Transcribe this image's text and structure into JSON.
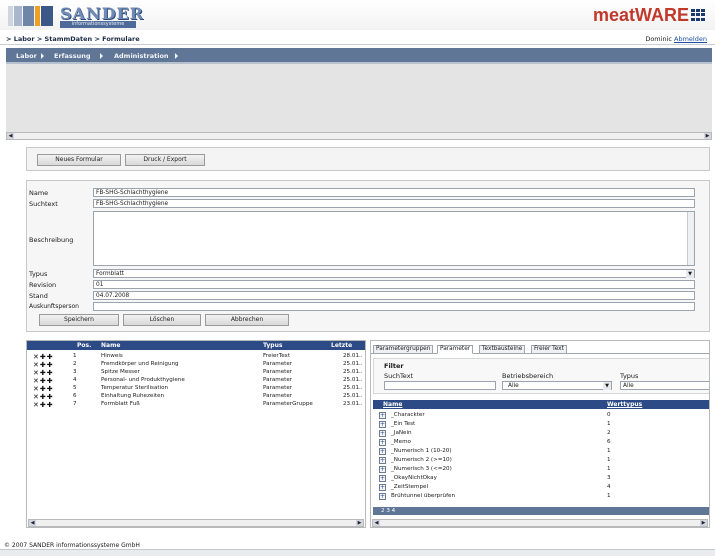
{
  "header": {
    "logo_word": "SANDER",
    "logo_sub": "informationssysteme",
    "brand": "meatWARE"
  },
  "breadcrumb": "> Labor > StammDaten > Formulare",
  "user": {
    "name": "Dominic",
    "logout": "Abmelden"
  },
  "nav": [
    "Labor",
    "Erfassung",
    "Administration"
  ],
  "toolbar": {
    "new": "Neues Formular",
    "print": "Druck / Export"
  },
  "form": {
    "labels": {
      "name": "Name",
      "suchtext": "Suchtext",
      "beschreibung": "Beschreibung",
      "typus": "Typus",
      "revision": "Revision",
      "stand": "Stand",
      "auskunft": "Auskunftsperson"
    },
    "values": {
      "name": "FB-SHG-Schlachthygiene",
      "suchtext": "FB-SHG-Schlachthygiene",
      "typus": "Formblatt",
      "revision": "01",
      "stand": "04.07.2008",
      "auskunft": ""
    },
    "buttons": {
      "save": "Speichern",
      "delete": "Löschen",
      "cancel": "Abbrechen"
    }
  },
  "items_table": {
    "headers": [
      "Pos.",
      "Name",
      "Typus",
      "Letzte"
    ],
    "rows": [
      {
        "pos": "1",
        "name": "Hinweis",
        "typus": "FreierText",
        "letzte": "28.01.."
      },
      {
        "pos": "2",
        "name": "Fremdkörper und Reinigung",
        "typus": "Parameter",
        "letzte": "25.01.."
      },
      {
        "pos": "3",
        "name": "Spitze Messer",
        "typus": "Parameter",
        "letzte": "25.01.."
      },
      {
        "pos": "4",
        "name": "Personal- und Produkthygiene",
        "typus": "Parameter",
        "letzte": "25.01.."
      },
      {
        "pos": "5",
        "name": "Temperatur Sterilisation",
        "typus": "Parameter",
        "letzte": "25.01.."
      },
      {
        "pos": "6",
        "name": "Einhaltung Ruhezeiten",
        "typus": "Parameter",
        "letzte": "25.01.."
      },
      {
        "pos": "7",
        "name": "Formblatt Fuß",
        "typus": "ParameterGruppe",
        "letzte": "23.01.."
      }
    ]
  },
  "params": {
    "tabs": [
      "Parametergruppen",
      "Parameter",
      "Textbausteine",
      "Freier Text"
    ],
    "filter": {
      "title": "Filter",
      "suchtext": "SuchText",
      "betriebsbereich": "Betriebsbereich",
      "betriebsbereich_value": "Alle",
      "typus": "Typus",
      "typus_value": "Alle"
    },
    "headers": [
      "Name",
      "Werttypus"
    ],
    "rows": [
      {
        "name": "_Charackter",
        "wert": "0"
      },
      {
        "name": "_Ein Test",
        "wert": "1"
      },
      {
        "name": "_JaNein",
        "wert": "2"
      },
      {
        "name": "_Memo",
        "wert": "6"
      },
      {
        "name": "_Numerisch 1 (10-20)",
        "wert": "1"
      },
      {
        "name": "_Numerisch 2 (>=10)",
        "wert": "1"
      },
      {
        "name": "_Numerisch 3 (<=20)",
        "wert": "1"
      },
      {
        "name": "_OkayNichtOkay",
        "wert": "3"
      },
      {
        "name": "_ZeitStempel",
        "wert": "4"
      },
      {
        "name": "Brühtunnel überprüfen",
        "wert": "1"
      }
    ],
    "pager": "2 3 4"
  },
  "footer": "© 2007 SANDER informationssysteme GmbH",
  "colors": {
    "nav": "#5f7697",
    "table_header": "#2c4a86",
    "brand": "#c0392b"
  }
}
